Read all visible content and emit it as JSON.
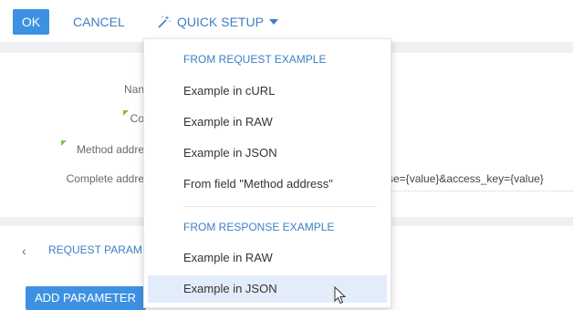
{
  "toolbar": {
    "ok_label": "OK",
    "cancel_label": "CANCEL",
    "quick_setup_label": "QUICK SETUP"
  },
  "form": {
    "rows": [
      {
        "label": "Nan",
        "value": "",
        "required": false
      },
      {
        "label": "Co",
        "value": "",
        "required": true
      },
      {
        "label": "Method addre",
        "value": "",
        "required": true
      },
      {
        "label": "Complete addre",
        "value": "se={value}&access_key={value}",
        "required": false
      }
    ]
  },
  "section": {
    "title": "REQUEST PARAM"
  },
  "actions": {
    "add_parameter_label": "ADD PARAMETER"
  },
  "dropdown": {
    "request_group_label": "FROM REQUEST EXAMPLE",
    "request_items": [
      "Example in cURL",
      "Example in RAW",
      "Example in JSON",
      "From field \"Method address\""
    ],
    "response_group_label": "FROM RESPONSE EXAMPLE",
    "response_items": [
      "Example in RAW",
      "Example in JSON"
    ],
    "hovered_item": "Example in JSON"
  },
  "colors": {
    "accent": "#3d91e2",
    "link": "#3d7fc2",
    "required": "#7cc142",
    "hover_bg": "#e3ecfa"
  }
}
